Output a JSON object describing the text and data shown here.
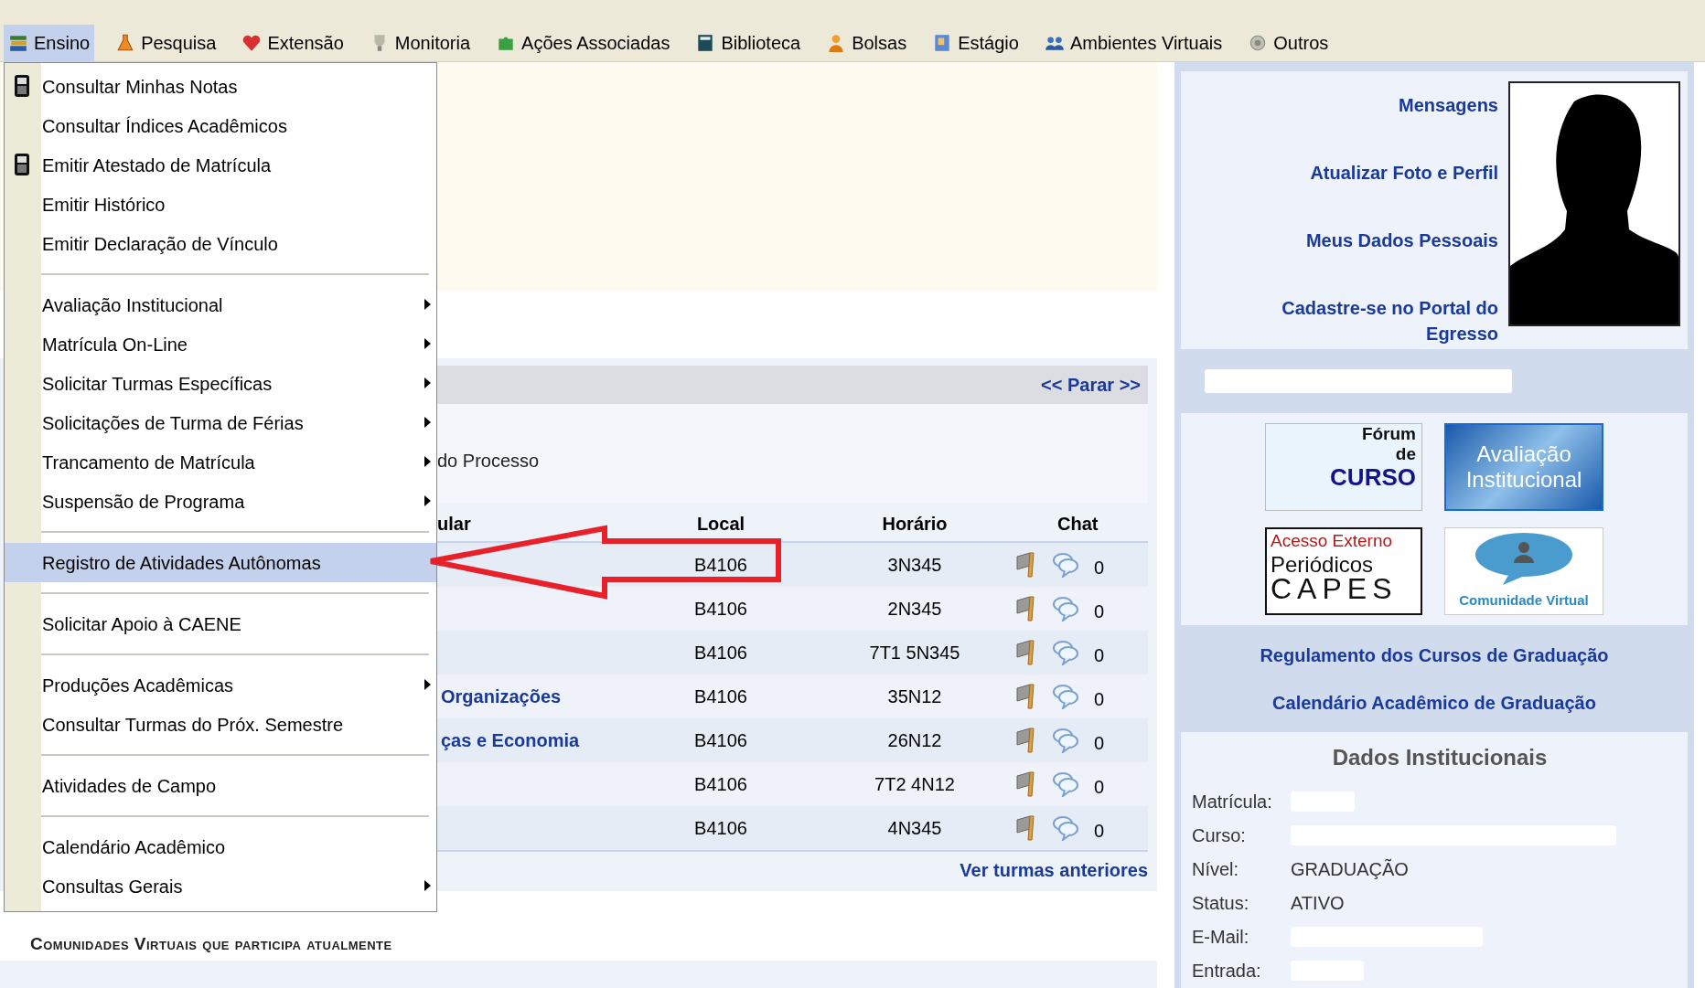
{
  "top_menu": [
    {
      "label": "Ensino",
      "selected": true
    },
    {
      "label": "Pesquisa",
      "selected": false
    },
    {
      "label": "Extensão",
      "selected": false
    },
    {
      "label": "Monitoria",
      "selected": false
    },
    {
      "label": "Ações Associadas",
      "selected": false
    },
    {
      "label": "Biblioteca",
      "selected": false
    },
    {
      "label": "Bolsas",
      "selected": false
    },
    {
      "label": "Estágio",
      "selected": false
    },
    {
      "label": "Ambientes Virtuais",
      "selected": false
    },
    {
      "label": "Outros",
      "selected": false
    }
  ],
  "dropdown": {
    "groups": [
      [
        {
          "label": "Consultar Minhas Notas",
          "submenu": false,
          "selected": false,
          "device_icon": true
        },
        {
          "label": "Consultar Índices Acadêmicos",
          "submenu": false,
          "selected": false,
          "device_icon": false
        },
        {
          "label": "Emitir Atestado de Matrícula",
          "submenu": false,
          "selected": false,
          "device_icon": true
        },
        {
          "label": "Emitir Histórico",
          "submenu": false,
          "selected": false,
          "device_icon": false
        },
        {
          "label": "Emitir Declaração de Vínculo",
          "submenu": false,
          "selected": false,
          "device_icon": false
        }
      ],
      [
        {
          "label": "Avaliação Institucional",
          "submenu": true,
          "selected": false,
          "device_icon": false
        },
        {
          "label": "Matrícula On-Line",
          "submenu": true,
          "selected": false,
          "device_icon": false
        },
        {
          "label": "Solicitar Turmas Específicas",
          "submenu": true,
          "selected": false,
          "device_icon": false
        },
        {
          "label": "Solicitações de Turma de Férias",
          "submenu": true,
          "selected": false,
          "device_icon": false
        },
        {
          "label": "Trancamento de Matrícula",
          "submenu": true,
          "selected": false,
          "device_icon": false
        },
        {
          "label": "Suspensão de Programa",
          "submenu": true,
          "selected": false,
          "device_icon": false
        }
      ],
      [
        {
          "label": "Registro de Atividades Autônomas",
          "submenu": false,
          "selected": true,
          "device_icon": false
        }
      ],
      [
        {
          "label": "Solicitar Apoio à CAENE",
          "submenu": false,
          "selected": false,
          "device_icon": false
        }
      ],
      [
        {
          "label": "Produções Acadêmicas",
          "submenu": true,
          "selected": false,
          "device_icon": false
        },
        {
          "label": "Consultar Turmas do Próx. Semestre",
          "submenu": false,
          "selected": false,
          "device_icon": false
        }
      ],
      [
        {
          "label": "Atividades de Campo",
          "submenu": false,
          "selected": false,
          "device_icon": false
        }
      ],
      [
        {
          "label": "Calendário Acadêmico",
          "submenu": false,
          "selected": false,
          "device_icon": false
        },
        {
          "label": "Consultas Gerais",
          "submenu": true,
          "selected": false,
          "device_icon": false
        }
      ]
    ]
  },
  "classes_panel": {
    "nav_link": "<< Parar >>",
    "note": "do Processo",
    "columns": [
      "ular",
      "Local",
      "Horário",
      "Chat"
    ],
    "rows": [
      {
        "local": "B4106",
        "schedule": "3N345",
        "chat_count": "0"
      },
      {
        "local": "B4106",
        "schedule": "2N345",
        "chat_count": "0"
      },
      {
        "local": "B4106",
        "schedule": "7T1 5N345",
        "chat_count": "0"
      },
      {
        "column_1": "Organizações",
        "local": "B4106",
        "schedule": "35N12",
        "chat_count": "0"
      },
      {
        "column_1": "ças e Economia",
        "local": "B4106",
        "schedule": "26N12",
        "chat_count": "0"
      },
      {
        "local": "B4106",
        "schedule": "7T2 4N12",
        "chat_count": "0"
      },
      {
        "local": "B4106",
        "schedule": "4N345",
        "chat_count": "0"
      }
    ],
    "footer_link": "Ver turmas anteriores"
  },
  "communities_heading": "Comunidades Virtuais que participa atualmente",
  "profile": {
    "links": [
      "Mensagens",
      "Atualizar Foto e Perfil",
      "Meus Dados Pessoais",
      "Cadastre-se no Portal do Egresso"
    ]
  },
  "banners": [
    {
      "kind": "forum",
      "lines": [
        "Fórum",
        "de",
        "CURSO"
      ]
    },
    {
      "kind": "evaluation",
      "lines": [
        "Avaliação",
        "Institucional"
      ]
    },
    {
      "kind": "capes",
      "lines": [
        "Acesso Externo",
        "Periódicos",
        "CAPES"
      ]
    },
    {
      "kind": "community",
      "lines": [
        "Comunidade Virtual"
      ]
    }
  ],
  "links": [
    "Regulamento dos Cursos de Graduação",
    "Calendário Acadêmico de Graduação"
  ],
  "institutional": {
    "title": "Dados Institucionais",
    "fields": [
      {
        "label": "Matrícula:",
        "redacted": true
      },
      {
        "label": "Curso:",
        "redacted": true
      },
      {
        "label": "Nível:",
        "redacted": false,
        "value": "GRADUAÇÃO"
      },
      {
        "label": "Status:",
        "redacted": false,
        "value": "ATIVO"
      },
      {
        "label": "E-Mail:",
        "redacted": true
      },
      {
        "label": "Entrada:",
        "redacted": true
      }
    ]
  }
}
